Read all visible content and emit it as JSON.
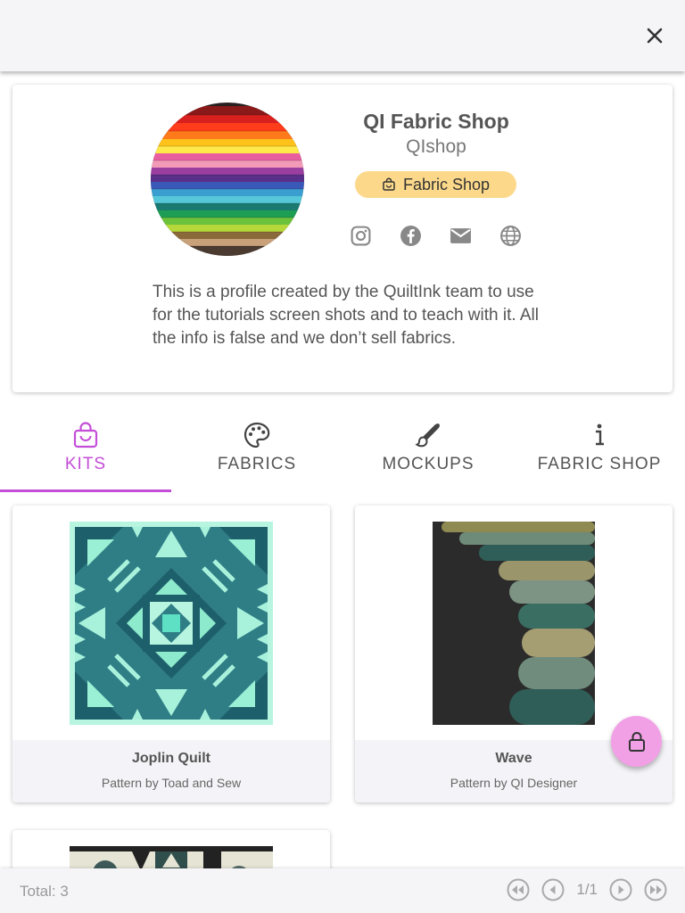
{
  "header": {
    "close_icon": "close-icon"
  },
  "profile": {
    "title": "QI Fabric Shop",
    "handle": "QIshop",
    "chip_label": "Fabric Shop",
    "chip_icon": "shopping-bag-icon",
    "chip_color": "#fcd98a",
    "socials": [
      "instagram-icon",
      "facebook-icon",
      "email-icon",
      "globe-icon"
    ],
    "bio": "This is a profile created by the QuiltInk team to use for the tutorials screen shots and to teach with it. All the info is false and we don’t sell fabrics."
  },
  "tabs": [
    {
      "label": "KITS",
      "icon": "shopping-bag-icon",
      "active": true
    },
    {
      "label": "FABRICS",
      "icon": "palette-icon",
      "active": false
    },
    {
      "label": "MOCKUPS",
      "icon": "brush-icon",
      "active": false
    },
    {
      "label": "FABRIC SHOP",
      "icon": "info-icon",
      "active": false
    }
  ],
  "accent_color": "#c44ed8",
  "kits": [
    {
      "name": "Joplin Quilt",
      "author": "Pattern by Toad and Sew"
    },
    {
      "name": "Wave",
      "author": "Pattern by QI Designer"
    }
  ],
  "fab": {
    "icon": "lock-icon",
    "color": "#f2a0e6"
  },
  "footer": {
    "total": "Total: 3",
    "page": "1/1",
    "buttons": [
      "first-page-icon",
      "previous-page-icon",
      "next-page-icon",
      "last-page-icon"
    ]
  }
}
